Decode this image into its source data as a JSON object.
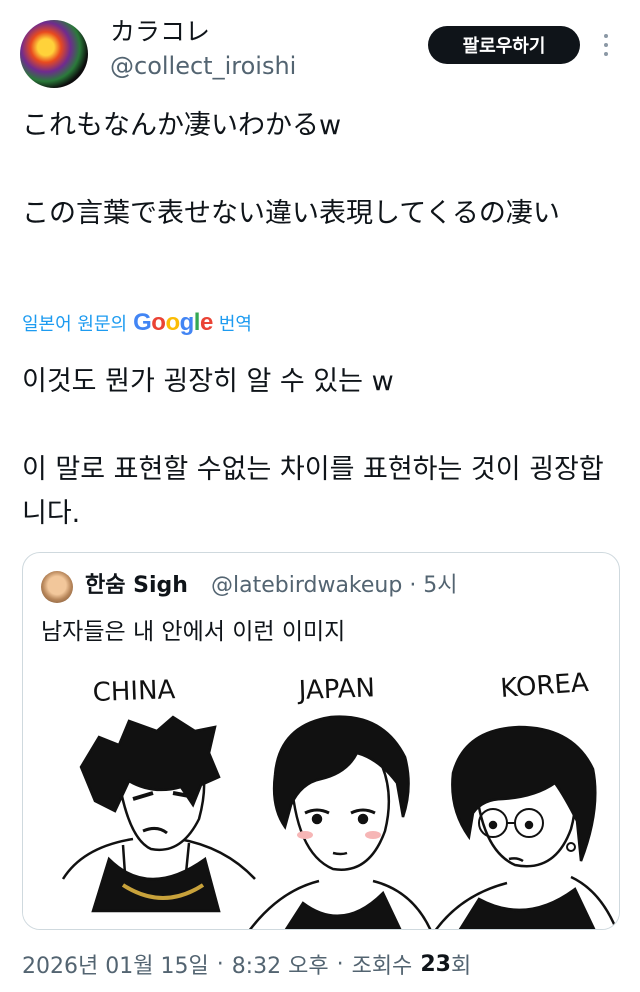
{
  "author": {
    "name": "カラコレ",
    "handle": "@collect_iroishi",
    "follow_label": "팔로우하기"
  },
  "tweet": {
    "lines": [
      "これもなんか凄いわかるw",
      "この言葉で表せない違い表現してくるの凄い"
    ],
    "translation_prefix": "일본어 원문의",
    "translation_brand": "Google",
    "translation_suffix": "번역",
    "translated_lines": [
      "이것도 뭔가 굉장히 알 수 있는 w",
      "이 말로 표현할 수없는 차이를 표현하는 것이 굉장합니다."
    ]
  },
  "quote": {
    "name": "한숨 Sigh",
    "handle_time": "@latebirdwakeup · 5시",
    "text": "남자들은 내 안에서 이런 이미지",
    "media_labels": [
      "CHINA",
      "JAPAN",
      "KOREA"
    ]
  },
  "footer": {
    "date": "2026년 01월 15일",
    "time": "8:32 오후",
    "views_label": "조회수",
    "views_count": "23",
    "views_suffix": "회"
  },
  "icons": {
    "more": "more-vertical-icon",
    "google": "google-logo"
  }
}
